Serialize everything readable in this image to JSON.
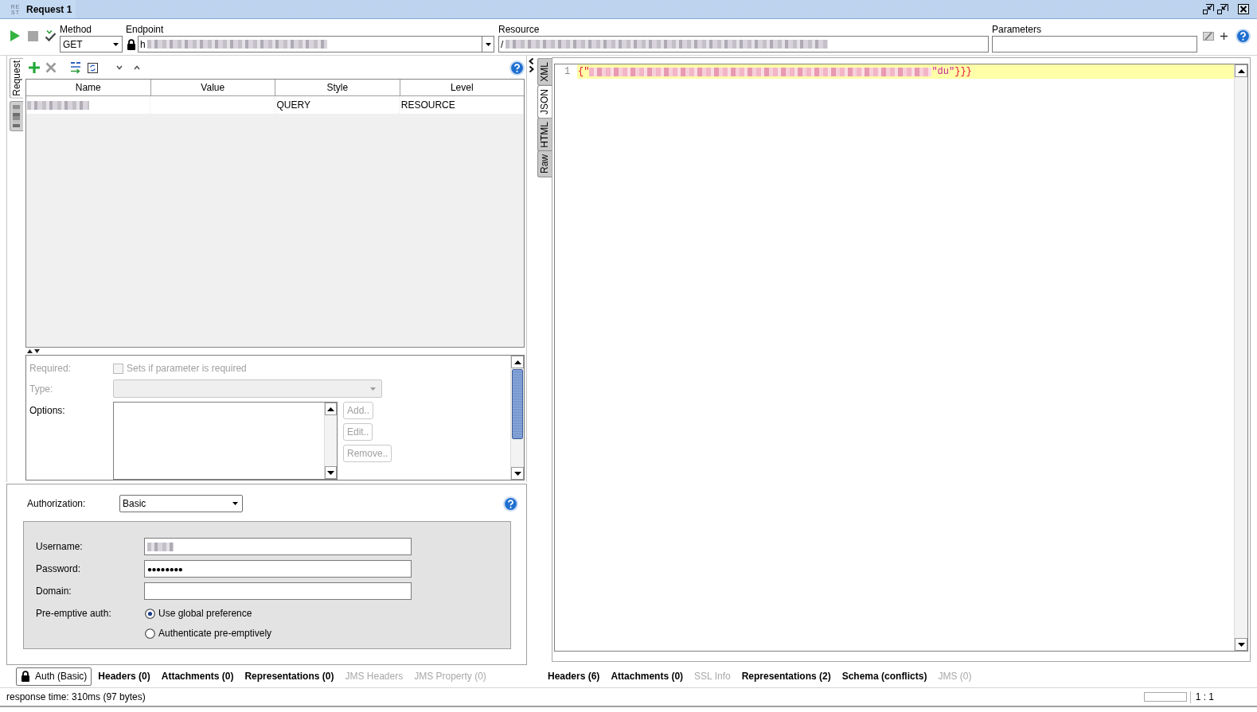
{
  "window": {
    "logo_lines": [
      "RE",
      "ST"
    ],
    "title": "Request 1"
  },
  "toolbar": {
    "method": {
      "label": "Method",
      "value": "GET"
    },
    "endpoint": {
      "label": "Endpoint",
      "value": "h",
      "redacted": true
    },
    "resource": {
      "label": "Resource",
      "value": "/",
      "redacted": true
    },
    "parameters": {
      "label": "Parameters"
    }
  },
  "request_panel": {
    "side_tabs": [
      {
        "label": "Request",
        "selected": true,
        "redacted": false
      },
      {
        "selected": false,
        "redacted": true
      }
    ],
    "table": {
      "columns": [
        "Name",
        "Value",
        "Style",
        "Level"
      ],
      "rows": [
        {
          "cells": [
            {
              "redacted": true
            },
            {
              "redacted": false
            },
            {
              "text": "QUERY",
              "redacted": false
            },
            {
              "text": "RESOURCE",
              "redacted": false
            }
          ]
        }
      ]
    },
    "detail": {
      "required": {
        "label": "Required:",
        "disabled": true,
        "checkbox_label": "Sets if parameter is required",
        "checked": false
      },
      "type": {
        "label": "Type:",
        "disabled": true
      },
      "options": {
        "label": "Options:",
        "disabled": false,
        "buttons": [
          {
            "label": "Add..",
            "disabled": true
          },
          {
            "label": "Edit..",
            "disabled": true
          },
          {
            "label": "Remove..",
            "disabled": true
          }
        ]
      }
    }
  },
  "auth_panel": {
    "label": "Authorization:",
    "value": "Basic",
    "fields": [
      {
        "label": "Username:",
        "redacted": true
      },
      {
        "label": "Password:",
        "value": "●●●●●●●●",
        "redacted": false
      },
      {
        "label": "Domain:",
        "redacted": false
      }
    ],
    "preemptive": {
      "label": "Pre-emptive auth:",
      "options": [
        {
          "label": "Use global preference",
          "selected": true
        },
        {
          "label": "Authenticate pre-emptively",
          "selected": false
        }
      ]
    }
  },
  "request_tabs": [
    {
      "label": "Auth (Basic)",
      "kind": "auth",
      "selected": true,
      "disabled": false
    },
    {
      "label": "Headers (0)",
      "kind": "plain",
      "selected": false,
      "disabled": false
    },
    {
      "label": "Attachments (0)",
      "kind": "plain",
      "selected": false,
      "disabled": false
    },
    {
      "label": "Representations (0)",
      "kind": "plain",
      "selected": false,
      "disabled": false
    },
    {
      "label": "JMS Headers",
      "kind": "plain",
      "selected": false,
      "disabled": true
    },
    {
      "label": "JMS Property (0)",
      "kind": "plain",
      "selected": false,
      "disabled": true
    }
  ],
  "response_panel": {
    "view_tabs": [
      {
        "label": "XML",
        "selected": false
      },
      {
        "label": "JSON",
        "selected": true
      },
      {
        "label": "HTML",
        "selected": false
      },
      {
        "label": "Raw",
        "selected": false
      }
    ],
    "lines": [
      {
        "number": "1",
        "highlighted": true,
        "tokens": [
          {
            "kind": "brace",
            "text": "{\""
          },
          {
            "kind": "redacted"
          },
          {
            "kind": "string",
            "text": "\"du\""
          },
          {
            "kind": "brace",
            "text": "}}}"
          }
        ]
      }
    ]
  },
  "response_tabs": [
    {
      "label": "Headers (6)",
      "kind": "plain",
      "selected": false,
      "disabled": false
    },
    {
      "label": "Attachments (0)",
      "kind": "plain",
      "selected": false,
      "disabled": false
    },
    {
      "label": "SSL Info",
      "kind": "plain",
      "selected": false,
      "disabled": true
    },
    {
      "label": "Representations (2)",
      "kind": "plain",
      "selected": false,
      "disabled": false
    },
    {
      "label": "Schema (conflicts)",
      "kind": "plain",
      "selected": false,
      "disabled": false
    },
    {
      "label": "JMS (0)",
      "kind": "plain",
      "selected": false,
      "disabled": true
    }
  ],
  "status_bar": {
    "text": "response time: 310ms (97 bytes)",
    "progress": {
      "level": 0
    },
    "ratio": "1 : 1"
  }
}
